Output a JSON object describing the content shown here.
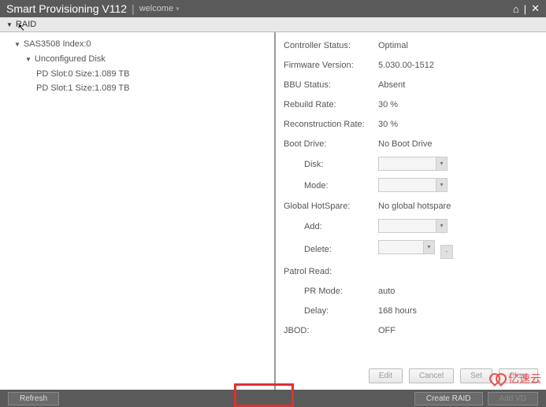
{
  "header": {
    "title": "Smart Provisioning V112",
    "welcome": "welcome",
    "home_icon": "⌂",
    "close_icon": "✕"
  },
  "subheader": {
    "label": "RAID"
  },
  "tree": {
    "controller": "SAS3508 Index:0",
    "unconfigured": "Unconfigured Disk",
    "pd0": "PD Slot:0 Size:1.089 TB",
    "pd1": "PD Slot:1 Size:1.089 TB"
  },
  "props": {
    "controller_status_label": "Controller Status:",
    "controller_status_value": "Optimal",
    "firmware_label": "Firmware Version:",
    "firmware_value": "5.030.00-1512",
    "bbu_label": "BBU Status:",
    "bbu_value": "Absent",
    "rebuild_label": "Rebuild Rate:",
    "rebuild_value": "30 %",
    "recon_label": "Reconstruction Rate:",
    "recon_value": "30 %",
    "boot_label": "Boot Drive:",
    "boot_value": "No Boot Drive",
    "disk_label": "Disk:",
    "mode_label": "Mode:",
    "hotspare_label": "Global HotSpare:",
    "hotspare_value": "No global hotspare",
    "add_label": "Add:",
    "delete_label": "Delete:",
    "patrol_label": "Patrol Read:",
    "prmode_label": "PR Mode:",
    "prmode_value": "auto",
    "delay_label": "Delay:",
    "delay_value": "168 hours",
    "jbod_label": "JBOD:",
    "jbod_value": "OFF"
  },
  "buttons": {
    "edit": "Edit",
    "cancel": "Cancel",
    "set": "Set",
    "clear": "Clear",
    "refresh": "Refresh",
    "create_raid": "Create RAID",
    "add_vd": "Add VD"
  },
  "watermark": "亿速云"
}
